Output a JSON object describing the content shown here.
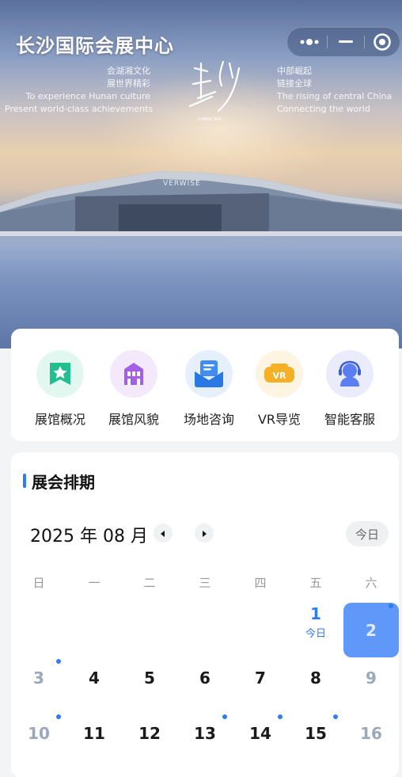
{
  "app": {
    "title": "长沙国际会展中心"
  },
  "capsule": {
    "more_icon": "more-dots-icon",
    "minimize_icon": "minimize-icon",
    "close_icon": "target-close-icon"
  },
  "hero": {
    "slogan_left": [
      "会湖湘文化",
      "展世界精彩",
      "To experience Hunan culture",
      "Present world-class achievements"
    ],
    "slogan_right": [
      "中部崛起",
      "链接全球",
      "The rising of central China",
      "Connecting the world"
    ],
    "building_sign": "VERWISE",
    "calligraphy_caption": "CHANG SHA"
  },
  "quick_menu": [
    {
      "label": "展馆概况",
      "icon": "star-badge-icon",
      "bg": "#e3f7f1",
      "color": "#1fbf8f"
    },
    {
      "label": "展馆风貌",
      "icon": "building-icon",
      "bg": "#f4e9fb",
      "color": "#a55ee6"
    },
    {
      "label": "场地咨询",
      "icon": "envelope-icon",
      "bg": "#e6f0fc",
      "color": "#3f8ef0"
    },
    {
      "label": "VR导览",
      "icon": "vr-headset-icon",
      "bg": "#fdf4e2",
      "color": "#f5b026"
    },
    {
      "label": "智能客服",
      "icon": "customer-service-icon",
      "bg": "#eaecfb",
      "color": "#5b7ef0"
    }
  ],
  "schedule": {
    "title": "展会排期",
    "month_label": "2025 年 08 月",
    "today_button": "今日",
    "prev_icon": "triangle-left-icon",
    "next_icon": "triangle-right-icon",
    "weekdays": [
      "日",
      "一",
      "二",
      "三",
      "四",
      "五",
      "六"
    ],
    "days": [
      {
        "n": "1",
        "sub": "今日",
        "col": 5,
        "row": 0,
        "today": true
      },
      {
        "n": "2",
        "col": 6,
        "row": 0,
        "selected": true,
        "dot": true
      },
      {
        "n": "3",
        "col": 0,
        "row": 1,
        "weekend": true,
        "dot": true
      },
      {
        "n": "4",
        "col": 1,
        "row": 1
      },
      {
        "n": "5",
        "col": 2,
        "row": 1
      },
      {
        "n": "6",
        "col": 3,
        "row": 1
      },
      {
        "n": "7",
        "col": 4,
        "row": 1
      },
      {
        "n": "8",
        "col": 5,
        "row": 1
      },
      {
        "n": "9",
        "col": 6,
        "row": 1,
        "weekend": true
      },
      {
        "n": "10",
        "col": 0,
        "row": 2,
        "weekend": true,
        "dot": true
      },
      {
        "n": "11",
        "col": 1,
        "row": 2
      },
      {
        "n": "12",
        "col": 2,
        "row": 2
      },
      {
        "n": "13",
        "col": 3,
        "row": 2,
        "dot": true
      },
      {
        "n": "14",
        "col": 4,
        "row": 2,
        "dot": true
      },
      {
        "n": "15",
        "col": 5,
        "row": 2,
        "dot": true
      },
      {
        "n": "16",
        "col": 6,
        "row": 2,
        "weekend": true
      }
    ],
    "accent": "#2f7bf2"
  }
}
